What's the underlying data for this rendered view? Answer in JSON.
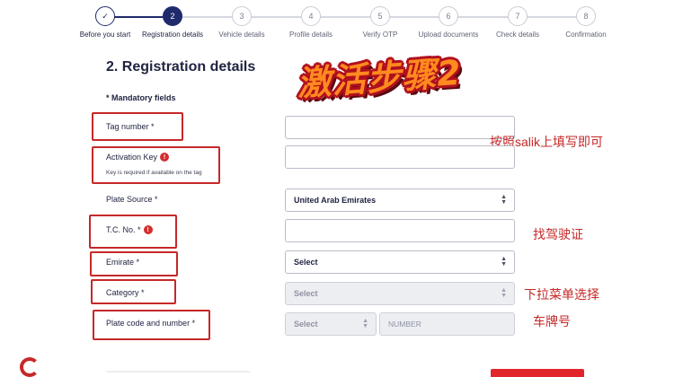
{
  "stepper": {
    "steps": [
      {
        "num": "✓",
        "label": "Before you start",
        "state": "complete"
      },
      {
        "num": "2",
        "label": "Registration details",
        "state": "active"
      },
      {
        "num": "3",
        "label": "Vehicle details",
        "state": "pending"
      },
      {
        "num": "4",
        "label": "Profile details",
        "state": "pending"
      },
      {
        "num": "5",
        "label": "Verify OTP",
        "state": "pending"
      },
      {
        "num": "6",
        "label": "Upload documents",
        "state": "pending"
      },
      {
        "num": "7",
        "label": "Check details",
        "state": "pending"
      },
      {
        "num": "8",
        "label": "Confirmation",
        "state": "pending"
      }
    ]
  },
  "form": {
    "title": "2. Registration details",
    "mandatory_note": "* Mandatory fields",
    "fields": {
      "tag_number": {
        "label": "Tag number *"
      },
      "activation_key": {
        "label": "Activation Key",
        "hint": "Key is required if available on the tag"
      },
      "plate_source": {
        "label": "Plate Source *",
        "value": "United Arab Emirates"
      },
      "tc_no": {
        "label": "T.C. No. *"
      },
      "emirate": {
        "label": "Emirate *",
        "value": "Select"
      },
      "category": {
        "label": "Category *",
        "value": "Select"
      },
      "plate_code": {
        "label": "Plate code and number *",
        "value": "Select",
        "number_placeholder": "NUMBER"
      }
    }
  },
  "annotations": {
    "stamp": "激活步骤2",
    "salik": "按照salik上填写即可",
    "license": "找驾驶证",
    "dropdown": "下拉菜单选择",
    "plate": "车牌号"
  },
  "colors": {
    "primary": "#1f2a6b",
    "annotation_red": "#c62828",
    "accent_red": "#e2252b"
  }
}
